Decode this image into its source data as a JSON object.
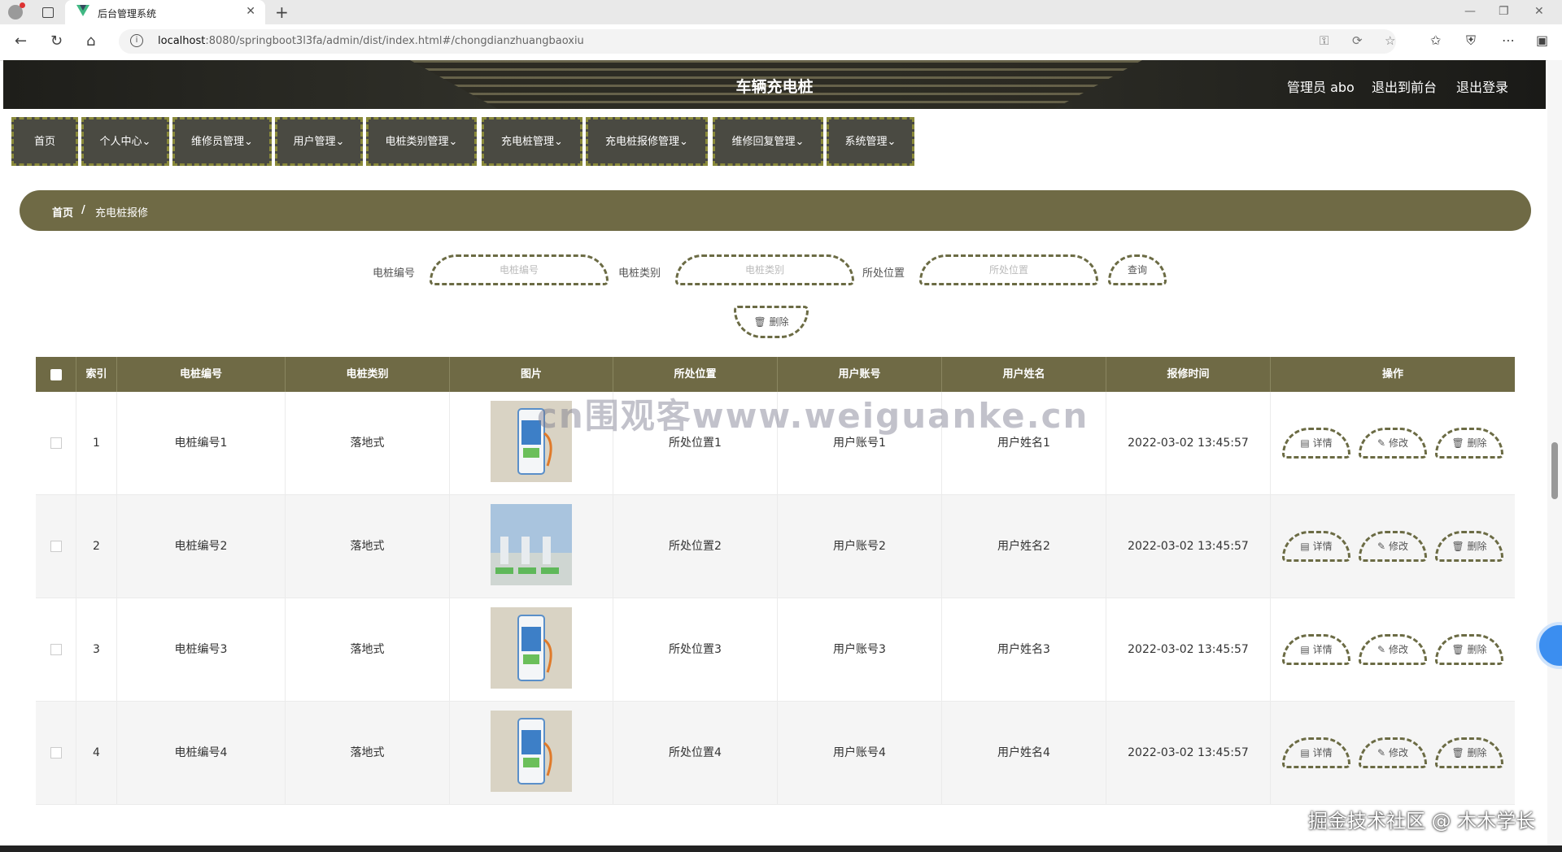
{
  "browser": {
    "tab_title": "后台管理系统",
    "url_host": "localhost",
    "url_path": ":8080/springboot3l3fa/admin/dist/index.html#/chongdianzhuangbaoxiu"
  },
  "header": {
    "title": "车辆充电桩",
    "user": "管理员 abo",
    "to_front": "退出到前台",
    "logout": "退出登录"
  },
  "menu": [
    "首页",
    "个人中心",
    "维修员管理",
    "用户管理",
    "电桩类别管理",
    "充电桩管理",
    "充电桩报修管理",
    "维修回复管理",
    "系统管理"
  ],
  "breadcrumb": {
    "home": "首页",
    "sep": "/",
    "current": "充电桩报修"
  },
  "search": {
    "f1_label": "电桩编号",
    "f1_placeholder": "电桩编号",
    "f2_label": "电桩类别",
    "f2_placeholder": "电桩类别",
    "f3_label": "所处位置",
    "f3_placeholder": "所处位置",
    "query": "查询",
    "delete": "删除"
  },
  "table": {
    "headers": [
      "索引",
      "电桩编号",
      "电桩类别",
      "图片",
      "所处位置",
      "用户账号",
      "用户姓名",
      "报修时间",
      "操作"
    ],
    "actions": {
      "detail": "详情",
      "edit": "修改",
      "delete": "删除"
    },
    "rows": [
      {
        "index": "1",
        "code": "电桩编号1",
        "type": "落地式",
        "location": "所处位置1",
        "account": "用户账号1",
        "name": "用户姓名1",
        "time": "2022-03-02 13:45:57"
      },
      {
        "index": "2",
        "code": "电桩编号2",
        "type": "落地式",
        "location": "所处位置2",
        "account": "用户账号2",
        "name": "用户姓名2",
        "time": "2022-03-02 13:45:57"
      },
      {
        "index": "3",
        "code": "电桩编号3",
        "type": "落地式",
        "location": "所处位置3",
        "account": "用户账号3",
        "name": "用户姓名3",
        "time": "2022-03-02 13:45:57"
      },
      {
        "index": "4",
        "code": "电桩编号4",
        "type": "落地式",
        "location": "所处位置4",
        "account": "用户账号4",
        "name": "用户姓名4",
        "time": "2022-03-02 13:45:57"
      }
    ]
  },
  "watermarks": {
    "center": "cn围观客www.weiguanke.cn",
    "corner": "掘金技术社区 @ 木木学长"
  },
  "colors": {
    "primary": "#6f6a45",
    "menu_bg": "#4a4a42",
    "dashed": "#6b6b44"
  }
}
